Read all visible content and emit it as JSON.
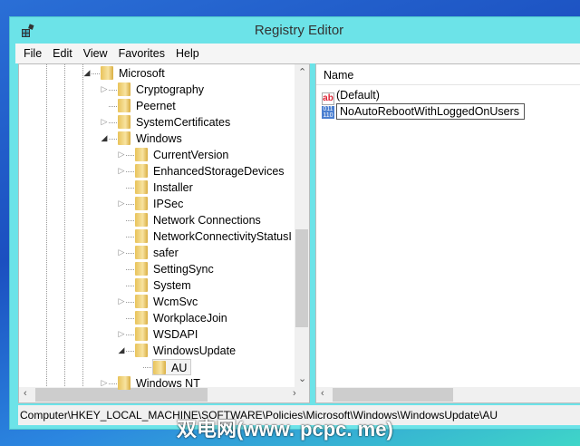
{
  "window": {
    "title": "Registry Editor"
  },
  "menu": [
    "File",
    "Edit",
    "View",
    "Favorites",
    "Help"
  ],
  "tree": [
    {
      "label": "Microsoft",
      "level": 1,
      "expander": "expanded"
    },
    {
      "label": "Cryptography",
      "level": 2,
      "expander": "collapsed"
    },
    {
      "label": "Peernet",
      "level": 2,
      "expander": "none"
    },
    {
      "label": "SystemCertificates",
      "level": 2,
      "expander": "collapsed"
    },
    {
      "label": "Windows",
      "level": 2,
      "expander": "expanded"
    },
    {
      "label": "CurrentVersion",
      "level": 3,
      "expander": "collapsed"
    },
    {
      "label": "EnhancedStorageDevices",
      "level": 3,
      "expander": "collapsed"
    },
    {
      "label": "Installer",
      "level": 3,
      "expander": "none"
    },
    {
      "label": "IPSec",
      "level": 3,
      "expander": "collapsed"
    },
    {
      "label": "Network Connections",
      "level": 3,
      "expander": "none"
    },
    {
      "label": "NetworkConnectivityStatusI",
      "level": 3,
      "expander": "none"
    },
    {
      "label": "safer",
      "level": 3,
      "expander": "collapsed"
    },
    {
      "label": "SettingSync",
      "level": 3,
      "expander": "none"
    },
    {
      "label": "System",
      "level": 3,
      "expander": "none"
    },
    {
      "label": "WcmSvc",
      "level": 3,
      "expander": "collapsed"
    },
    {
      "label": "WorkplaceJoin",
      "level": 3,
      "expander": "none"
    },
    {
      "label": "WSDAPI",
      "level": 3,
      "expander": "collapsed"
    },
    {
      "label": "WindowsUpdate",
      "level": 3,
      "expander": "expanded"
    },
    {
      "label": "AU",
      "level": 4,
      "expander": "none",
      "selected": true
    },
    {
      "label": "Windows NT",
      "level": 2,
      "expander": "collapsed"
    }
  ],
  "list": {
    "header": "Name",
    "values": [
      {
        "name": "(Default)",
        "icon": "string-value-icon"
      },
      {
        "name": "NoAutoRebootWithLoggedOnUsers",
        "icon": "dword-value-icon",
        "editing": true
      }
    ]
  },
  "status": "Computer\\HKEY_LOCAL_MACHINE\\SOFTWARE\\Policies\\Microsoft\\Windows\\WindowsUpdate\\AU",
  "watermark": "双电网(www. pcpc. me)"
}
